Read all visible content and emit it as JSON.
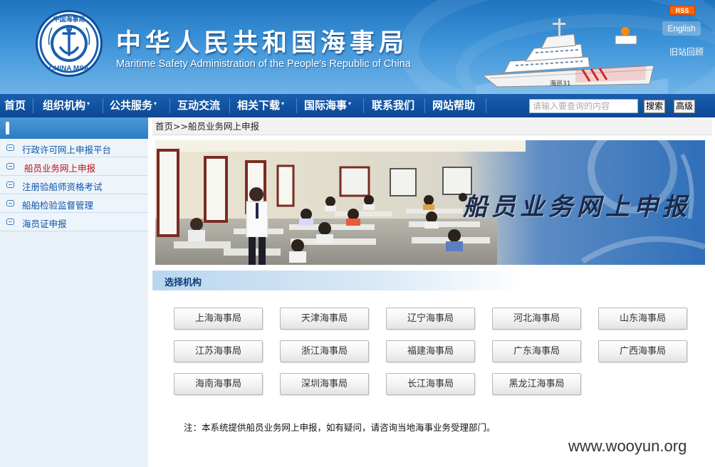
{
  "header": {
    "title": "中华人民共和国海事局",
    "subtitle": "Maritime Safety Administration of the People's Republic of China",
    "logo_text": "CHINA MSA",
    "logo_top_text": "中国海事局",
    "ship_text": "海巡31",
    "rss_label": "RSS",
    "lang_label": "English",
    "old_site_label": "旧站回顾"
  },
  "nav": {
    "items": [
      {
        "label": "首页",
        "has_dropdown": false
      },
      {
        "label": "组织机构",
        "has_dropdown": true
      },
      {
        "label": "公共服务",
        "has_dropdown": true
      },
      {
        "label": "互动交流",
        "has_dropdown": false
      },
      {
        "label": "相关下载",
        "has_dropdown": true
      },
      {
        "label": "国际海事",
        "has_dropdown": true
      },
      {
        "label": "联系我们",
        "has_dropdown": false
      },
      {
        "label": "网站帮助",
        "has_dropdown": false
      }
    ],
    "dropdown_arrow": "▾",
    "search_placeholder": "请输入要查询的内容",
    "search_button": "搜索",
    "advanced_button": "高级"
  },
  "sidebar": {
    "items": [
      {
        "label": "行政许可网上申报平台",
        "active": false
      },
      {
        "label": "船员业务网上申报",
        "active": true
      },
      {
        "label": "注册验船师资格考试",
        "active": false
      },
      {
        "label": "船舶检验监督管理",
        "active": false
      },
      {
        "label": "海员证申报",
        "active": false
      }
    ]
  },
  "main": {
    "breadcrumb": "首页>>船员业务网上申报",
    "banner_title": "船员业务网上申报",
    "section_title": "选择机构",
    "orgs": [
      "上海海事局",
      "天津海事局",
      "辽宁海事局",
      "河北海事局",
      "山东海事局",
      "江苏海事局",
      "浙江海事局",
      "福建海事局",
      "广东海事局",
      "广西海事局",
      "海南海事局",
      "深圳海事局",
      "长江海事局",
      "黑龙江海事局"
    ],
    "note": "注：本系统提供船员业务网上申报，如有疑问，请咨询当地海事业务受理部门。"
  },
  "watermark": "www.wooyun.org",
  "colors": {
    "header_blue": "#2f85cf",
    "nav_blue": "#0b4896",
    "sidebar_link": "#0f55a8",
    "sidebar_active": "#c0101a",
    "section_title": "#103c78"
  }
}
